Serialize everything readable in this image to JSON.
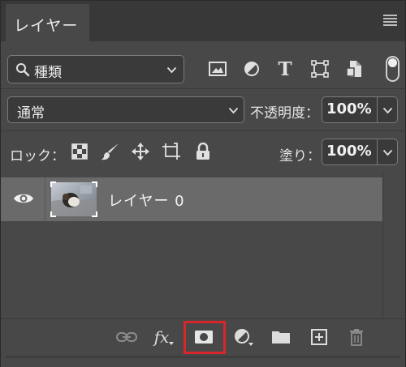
{
  "panel": {
    "tab_label": "レイヤー",
    "menu_icon": "hamburger-menu-icon"
  },
  "filter": {
    "kind_label": "種類",
    "icons": [
      "image-filter-icon",
      "adjustment-filter-icon",
      "type-filter-icon",
      "shape-filter-icon",
      "smart-object-filter-icon"
    ],
    "type_glyph": "T",
    "toggle_on": true
  },
  "blend": {
    "mode": "通常",
    "opacity_label": "不透明度：",
    "opacity_value": "100%"
  },
  "lock": {
    "label": "ロック：",
    "icons": [
      "lock-transparent-pixels-icon",
      "lock-image-pixels-icon",
      "lock-position-icon",
      "lock-artboard-icon",
      "lock-all-icon"
    ],
    "fill_label": "塗り：",
    "fill_value": "100%"
  },
  "layers": [
    {
      "name": "レイヤー 0",
      "visible": true,
      "selected": true,
      "has_mask": true
    }
  ],
  "bottom_toolbar": {
    "fx_label": "fx",
    "icons": [
      "link-layers-icon",
      "layer-style-icon",
      "add-mask-icon",
      "adjustment-layer-icon",
      "new-group-folder-icon",
      "new-layer-icon",
      "delete-layer-icon"
    ],
    "highlighted": "add-mask-icon",
    "highlight_color": "#d8262a"
  },
  "colors": {
    "panel_bg": "#484848",
    "tabbar_bg": "#383838",
    "selected_row": "#6a6a6a",
    "field_bg": "#3a3a3a"
  }
}
